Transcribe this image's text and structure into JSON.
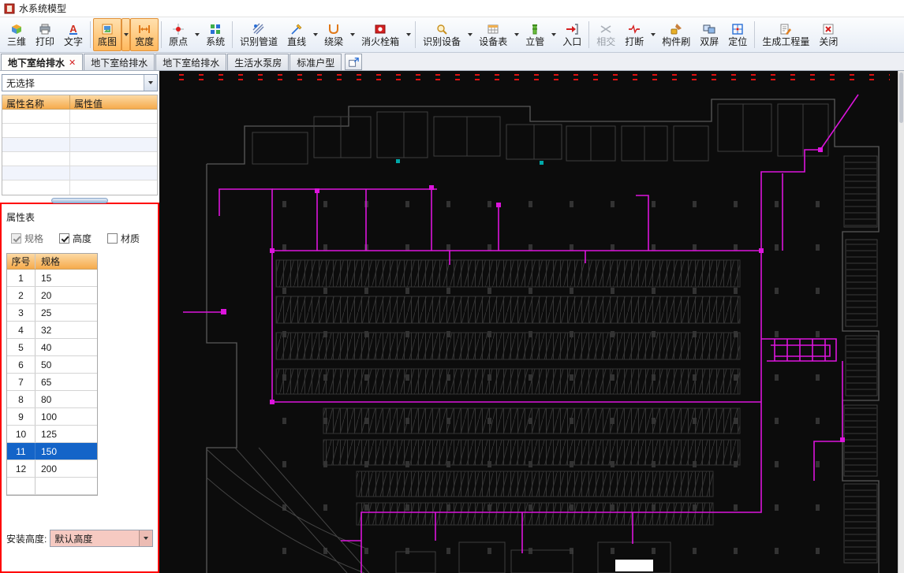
{
  "window": {
    "title": "水系统模型"
  },
  "toolbar": {
    "buttons": [
      {
        "id": "3d",
        "label": "三维"
      },
      {
        "id": "print",
        "label": "打印"
      },
      {
        "id": "text",
        "label": "文字"
      },
      {
        "id": "basemap",
        "label": "底图",
        "active": true,
        "dropdown": true
      },
      {
        "id": "width",
        "label": "宽度",
        "active": true
      },
      {
        "id": "origin",
        "label": "原点",
        "dropdown": true
      },
      {
        "id": "system",
        "label": "系统"
      },
      {
        "id": "identify-pipes",
        "label": "识别管道"
      },
      {
        "id": "line",
        "label": "直线",
        "dropdown": true
      },
      {
        "id": "around-beam",
        "label": "绕梁",
        "dropdown": true
      },
      {
        "id": "hydrant-box",
        "label": "消火栓箱",
        "dropdown": true
      },
      {
        "id": "identify-device",
        "label": "识别设备",
        "dropdown": true
      },
      {
        "id": "device-table",
        "label": "设备表",
        "dropdown": true
      },
      {
        "id": "riser",
        "label": "立管",
        "dropdown": true
      },
      {
        "id": "entrance",
        "label": "入口"
      },
      {
        "id": "intersect",
        "label": "相交",
        "disabled": true
      },
      {
        "id": "break",
        "label": "打断",
        "dropdown": true
      },
      {
        "id": "component-brush",
        "label": "构件刷"
      },
      {
        "id": "dual-screen",
        "label": "双屏"
      },
      {
        "id": "locate",
        "label": "定位"
      },
      {
        "id": "generate-quantity",
        "label": "生成工程量"
      },
      {
        "id": "close",
        "label": "关闭"
      }
    ]
  },
  "tabs": {
    "close_glyph": "✕",
    "items": [
      {
        "label": "地下室给排水",
        "active": true,
        "closable": true
      },
      {
        "label": "地下室给排水"
      },
      {
        "label": "地下室给排水"
      },
      {
        "label": "生活水泵房"
      },
      {
        "label": "标准户型"
      }
    ]
  },
  "left_panel": {
    "selection_dropdown": "无选择",
    "property_grid": {
      "col1": "属性名称",
      "col2": "属性值",
      "empty_rows": 6
    },
    "attr_panel": {
      "title": "属性表",
      "checkboxes": {
        "spec": {
          "label": "规格",
          "checked": true,
          "disabled": true
        },
        "height": {
          "label": "高度",
          "checked": true,
          "disabled": false
        },
        "material": {
          "label": "材质",
          "checked": false,
          "disabled": false
        }
      },
      "table": {
        "col_no": "序号",
        "col_spec": "规格",
        "selected_index": 10,
        "rows": [
          {
            "no": "1",
            "spec": "15"
          },
          {
            "no": "2",
            "spec": "20"
          },
          {
            "no": "3",
            "spec": "25"
          },
          {
            "no": "4",
            "spec": "32"
          },
          {
            "no": "5",
            "spec": "40"
          },
          {
            "no": "6",
            "spec": "50"
          },
          {
            "no": "7",
            "spec": "65"
          },
          {
            "no": "8",
            "spec": "80"
          },
          {
            "no": "9",
            "spec": "100"
          },
          {
            "no": "10",
            "spec": "125"
          },
          {
            "no": "11",
            "spec": "150",
            "selected": true
          },
          {
            "no": "12",
            "spec": "200"
          }
        ]
      },
      "install_height_label": "安装高度:",
      "install_height_value": "默认高度"
    }
  },
  "colors": {
    "accent_orange": "#f6ab4c",
    "selection_blue": "#1464c8",
    "panel_highlight_red": "#ff0000",
    "pipe_magenta": "#dc14dc",
    "cad_background": "#0c0c0c",
    "cad_marker_red": "#dd1111"
  }
}
